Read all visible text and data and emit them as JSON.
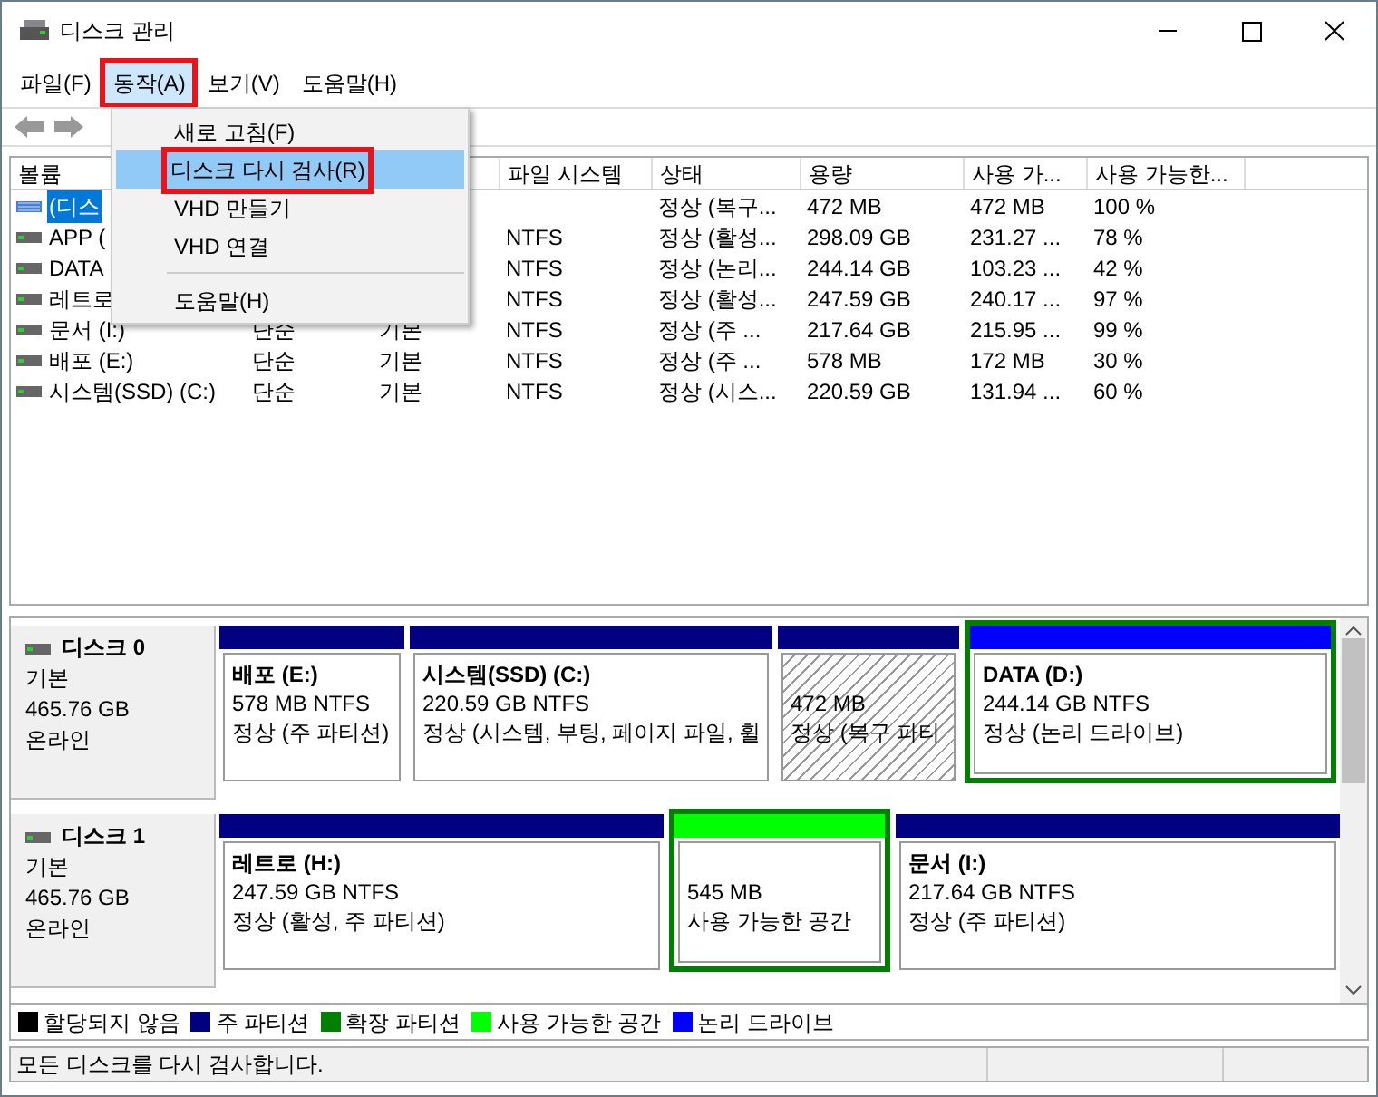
{
  "window": {
    "title": "디스크 관리"
  },
  "menubar": [
    {
      "label": "파일(F)",
      "open": false,
      "highlighted": false
    },
    {
      "label": "동작(A)",
      "open": true,
      "highlighted": true
    },
    {
      "label": "보기(V)",
      "open": false,
      "highlighted": false
    },
    {
      "label": "도움말(H)",
      "open": false,
      "highlighted": false
    }
  ],
  "menu": {
    "items": [
      {
        "kind": "item",
        "label": "새로 고침(F)",
        "selected": false,
        "highlighted": false
      },
      {
        "kind": "item",
        "label": "디스크 다시 검사(R)",
        "selected": true,
        "highlighted": true
      },
      {
        "kind": "item",
        "label": "VHD 만들기",
        "selected": false,
        "highlighted": false
      },
      {
        "kind": "item",
        "label": "VHD 연결",
        "selected": false,
        "highlighted": false
      },
      {
        "kind": "separator"
      },
      {
        "kind": "item",
        "label": "도움말(H)",
        "selected": false,
        "highlighted": false
      }
    ]
  },
  "table": {
    "columns": [
      "볼륨",
      "",
      "",
      "파일 시스템",
      "상태",
      "용량",
      "사용 가...",
      "사용 가능한..."
    ],
    "rows": [
      {
        "selected": true,
        "cells": [
          "(디스",
          "",
          "",
          "",
          "정상 (복구...",
          "472 MB",
          "472 MB",
          "100 %"
        ]
      },
      {
        "selected": false,
        "cells": [
          "APP (",
          "",
          "",
          "NTFS",
          "정상 (활성...",
          "298.09 GB",
          "231.27 ...",
          "78 %"
        ]
      },
      {
        "selected": false,
        "cells": [
          "DATA",
          "",
          "",
          "NTFS",
          "정상 (논리...",
          "244.14 GB",
          "103.23 ...",
          "42 %"
        ]
      },
      {
        "selected": false,
        "cells": [
          "레트로",
          "",
          "",
          "NTFS",
          "정상 (활성...",
          "247.59 GB",
          "240.17 ...",
          "97 %"
        ]
      },
      {
        "selected": false,
        "cells": [
          "문서 (I:)",
          "단순",
          "기본",
          "NTFS",
          "정상 (주 ...",
          "217.64 GB",
          "215.95 ...",
          "99 %"
        ]
      },
      {
        "selected": false,
        "cells": [
          "배포 (E:)",
          "단순",
          "기본",
          "NTFS",
          "정상 (주 ...",
          "578 MB",
          "172 MB",
          "30 %"
        ]
      },
      {
        "selected": false,
        "cells": [
          "시스템(SSD) (C:)",
          "단순",
          "기본",
          "NTFS",
          "정상 (시스...",
          "220.59 GB",
          "131.94 ...",
          "60 %"
        ]
      }
    ]
  },
  "disks": [
    {
      "name": "디스크 0",
      "type": "기본",
      "size": "465.76 GB",
      "state": "온라인",
      "partitions": [
        {
          "kind": "primary",
          "selected": false,
          "in_extended": false,
          "label": "배포  (E:)",
          "detail": "578 MB NTFS",
          "status": "정상 (주 파티션)"
        },
        {
          "kind": "primary",
          "selected": false,
          "in_extended": false,
          "label": "시스템(SSD)  (C:)",
          "detail": "220.59 GB NTFS",
          "status": "정상 (시스템, 부팅, 페이지 파일, 휠"
        },
        {
          "kind": "primary",
          "selected": true,
          "in_extended": false,
          "detail": "472 MB",
          "status": "정상 (복구 파티"
        },
        {
          "kind": "logical",
          "selected": false,
          "in_extended": true,
          "label": "DATA  (D:)",
          "detail": "244.14 GB NTFS",
          "status": "정상 (논리 드라이브)"
        }
      ]
    },
    {
      "name": "디스크 1",
      "type": "기본",
      "size": "465.76 GB",
      "state": "온라인",
      "partitions": [
        {
          "kind": "primary",
          "selected": false,
          "in_extended": false,
          "label": "레트로  (H:)",
          "detail": "247.59 GB NTFS",
          "status": "정상 (활성, 주 파티션)"
        },
        {
          "kind": "free",
          "selected": false,
          "in_extended": true,
          "detail": "545 MB",
          "status": "사용 가능한 공간"
        },
        {
          "kind": "primary",
          "selected": false,
          "in_extended": false,
          "label": "문서  (I:)",
          "detail": "217.64 GB NTFS",
          "status": "정상 (주 파티션)"
        }
      ]
    }
  ],
  "legend": [
    {
      "label": "할당되지 않음",
      "color": "#000000"
    },
    {
      "label": "주 파티션",
      "color": "#000080"
    },
    {
      "label": "확장 파티션",
      "color": "#008000"
    },
    {
      "label": "사용 가능한 공간",
      "color": "#00ff00"
    },
    {
      "label": "논리 드라이브",
      "color": "#0000ff"
    }
  ],
  "status_bar": "모든 디스크를 다시 검사합니다."
}
